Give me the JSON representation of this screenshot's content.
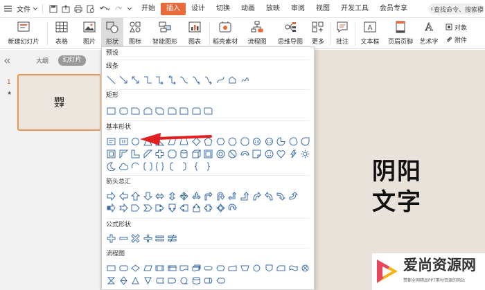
{
  "menubar": {
    "file_label": "文件",
    "ribbon_tabs": [
      {
        "label": "开始",
        "active": false
      },
      {
        "label": "插入",
        "active": true
      },
      {
        "label": "设计",
        "active": false
      },
      {
        "label": "切换",
        "active": false
      },
      {
        "label": "动画",
        "active": false
      },
      {
        "label": "放映",
        "active": false
      },
      {
        "label": "审阅",
        "active": false
      },
      {
        "label": "视图",
        "active": false
      },
      {
        "label": "开发工具",
        "active": false
      },
      {
        "label": "会员专享",
        "active": false
      }
    ],
    "search_placeholder": "查找命令、搜索模"
  },
  "toolbar": {
    "new_slide": "新建幻灯片",
    "table": "表格",
    "picture": "图片",
    "shape": "形状",
    "icons": "图标",
    "smartart": "智能图形",
    "chart": "图表",
    "material": "稻壳素材",
    "flowchart": "流程图",
    "mindmap": "思维导图",
    "more": "更多",
    "comment": "批注",
    "textbox": "文本框",
    "header_footer": "页眉页脚",
    "wordart": "艺术字",
    "object": "对象",
    "attachment": "附件"
  },
  "panel": {
    "tab_outline": "大纲",
    "tab_slides": "幻灯片",
    "slide_number": "1",
    "slide_star": "★",
    "thumb_line1": "阴阳",
    "thumb_line2": "文字"
  },
  "slide": {
    "line1": "阴阳",
    "line2": "文字"
  },
  "dropdown": {
    "title": "预设",
    "categories": {
      "lines": "线条",
      "rect": "矩形",
      "basic": "基本形状",
      "arrows": "箭头总汇",
      "formula": "公式形状",
      "flow": "流程图"
    }
  },
  "watermark": {
    "title": "爱尚资源网",
    "subtitle": "赞都全网精品PPT素材资源的网站"
  },
  "colors": {
    "accent": "#e86a3a",
    "arrow": "#e02020",
    "shape_stroke": "#3b6ea8"
  }
}
